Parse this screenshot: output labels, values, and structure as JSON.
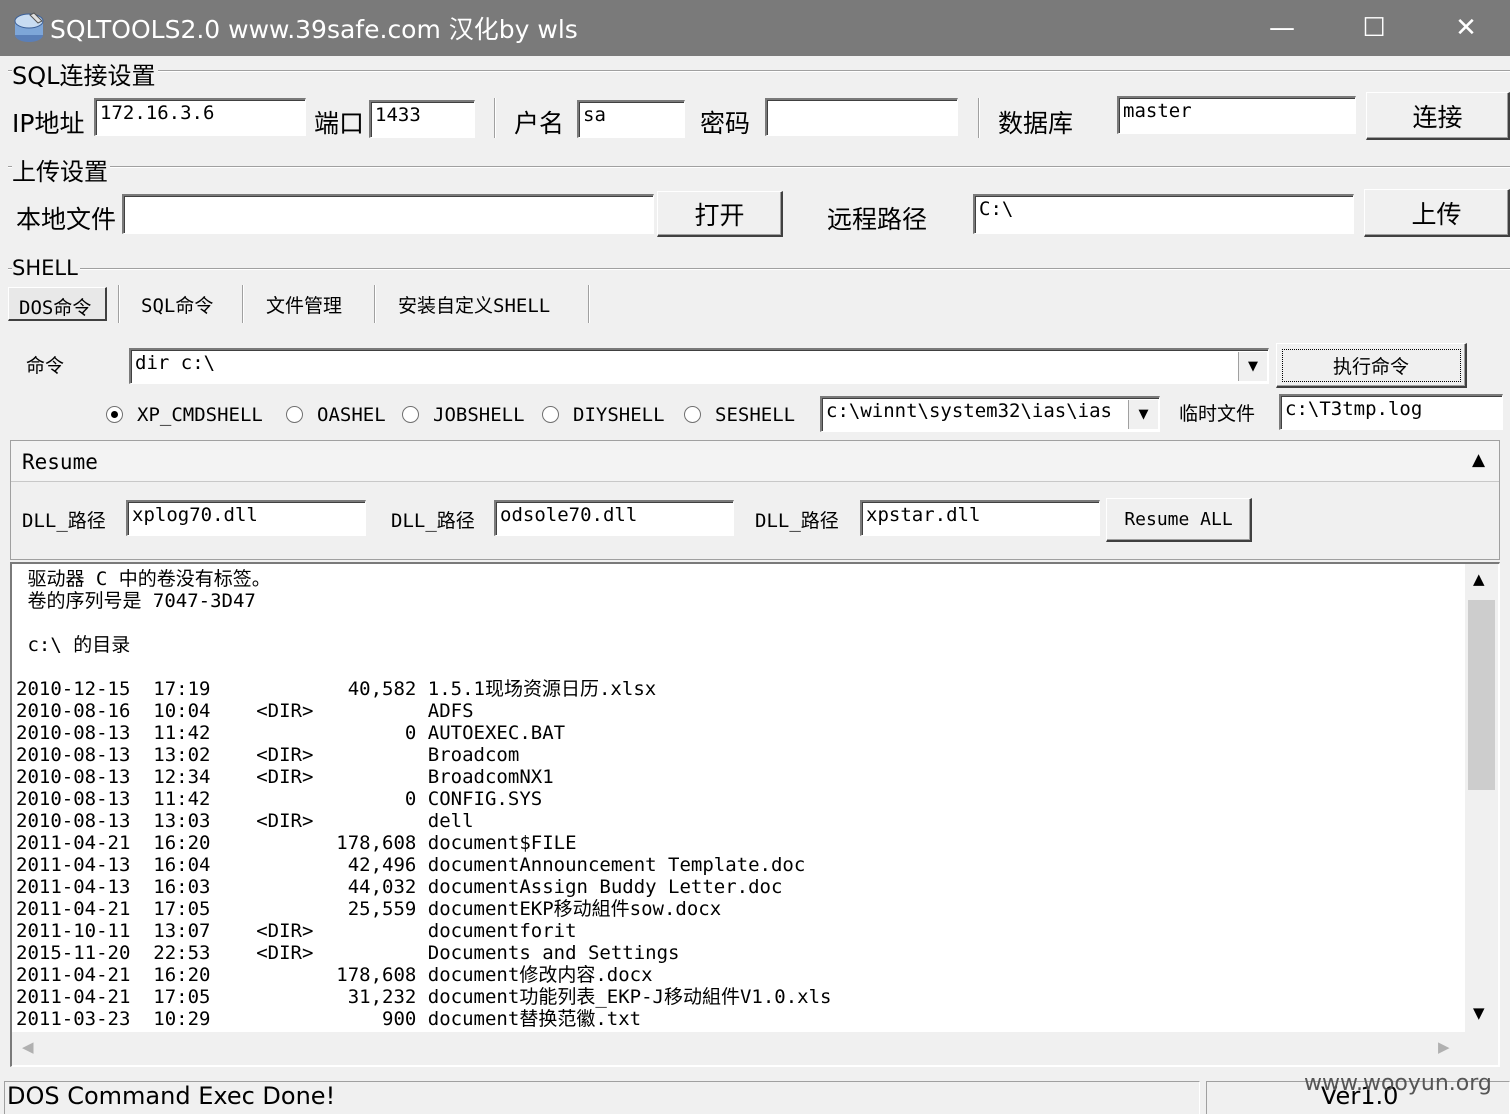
{
  "window": {
    "title": "SQLTOOLS2.0 www.39safe.com 汉化by wls",
    "minimize": "—",
    "maximize": "☐",
    "close": "✕",
    "icon": "app-icon"
  },
  "sql_connection": {
    "group_title": "SQL连接设置",
    "ip_label": "IP地址",
    "ip_value": "172.16.3.6",
    "port_label": "端口",
    "port_value": "1433",
    "user_label": "户名",
    "user_value": "sa",
    "password_label": "密码",
    "password_value": "",
    "database_label": "数据库",
    "database_value": "master",
    "connect_button": "连接"
  },
  "upload": {
    "group_title": "上传设置",
    "local_file_label": "本地文件",
    "local_file_value": "",
    "open_button": "打开",
    "remote_path_label": "远程路径",
    "remote_path_value": "C:\\",
    "upload_button": "上传"
  },
  "shell": {
    "group_title": "SHELL",
    "tabs": [
      "DOS命令",
      "SQL命令",
      "文件管理",
      "安装自定义SHELL"
    ],
    "command_label": "命令",
    "command_value": "dir c:\\",
    "execute_button": "执行命令",
    "shell_options": [
      "XP_CMDSHELL",
      "OASHEL",
      "JOBSHELL",
      "DIYSHELL",
      "SESHELL"
    ],
    "selected_option": "XP_CMDSHELL",
    "shell_path_value": "c:\\winnt\\system32\\ias\\ias",
    "temp_file_label": "临时文件",
    "temp_file_value": "c:\\T3tmp.log"
  },
  "resume": {
    "title": "Resume",
    "collapse_glyph": "▲",
    "dll_label": "DLL_路径",
    "dll1": "xplog70.dll",
    "dll2": "odsole70.dll",
    "dll3": "xpstar.dll",
    "resume_all_button": "Resume ALL"
  },
  "output": {
    "lines": [
      " 驱动器 C 中的卷没有标签。",
      " 卷的序列号是 7047-3D47",
      "",
      " c:\\ 的目录",
      "",
      "2010-12-15  17:19            40,582 1.5.1现场资源日历.xlsx",
      "2010-08-16  10:04    <DIR>          ADFS",
      "2010-08-13  11:42                 0 AUTOEXEC.BAT",
      "2010-08-13  13:02    <DIR>          Broadcom",
      "2010-08-13  12:34    <DIR>          BroadcomNX1",
      "2010-08-13  11:42                 0 CONFIG.SYS",
      "2010-08-13  13:03    <DIR>          dell",
      "2011-04-21  16:20           178,608 document$FILE",
      "2011-04-13  16:04            42,496 documentAnnouncement Template.doc",
      "2011-04-13  16:03            44,032 documentAssign Buddy Letter.doc",
      "2011-04-21  17:05            25,559 documentEKP移动組件sow.docx",
      "2011-10-11  13:07    <DIR>          documentforit",
      "2015-11-20  22:53    <DIR>          Documents and Settings",
      "2011-04-21  16:20           178,608 document修改内容.docx",
      "2011-04-21  17:05            31,232 document功能列表_EKP-J移动組件V1.0.xls",
      "2011-03-23  10:29               900 document替换范徽.txt"
    ]
  },
  "status": {
    "message": "DOS Command Exec Done!",
    "version": "Ver1.0",
    "watermark": "www.wooyun.org"
  }
}
